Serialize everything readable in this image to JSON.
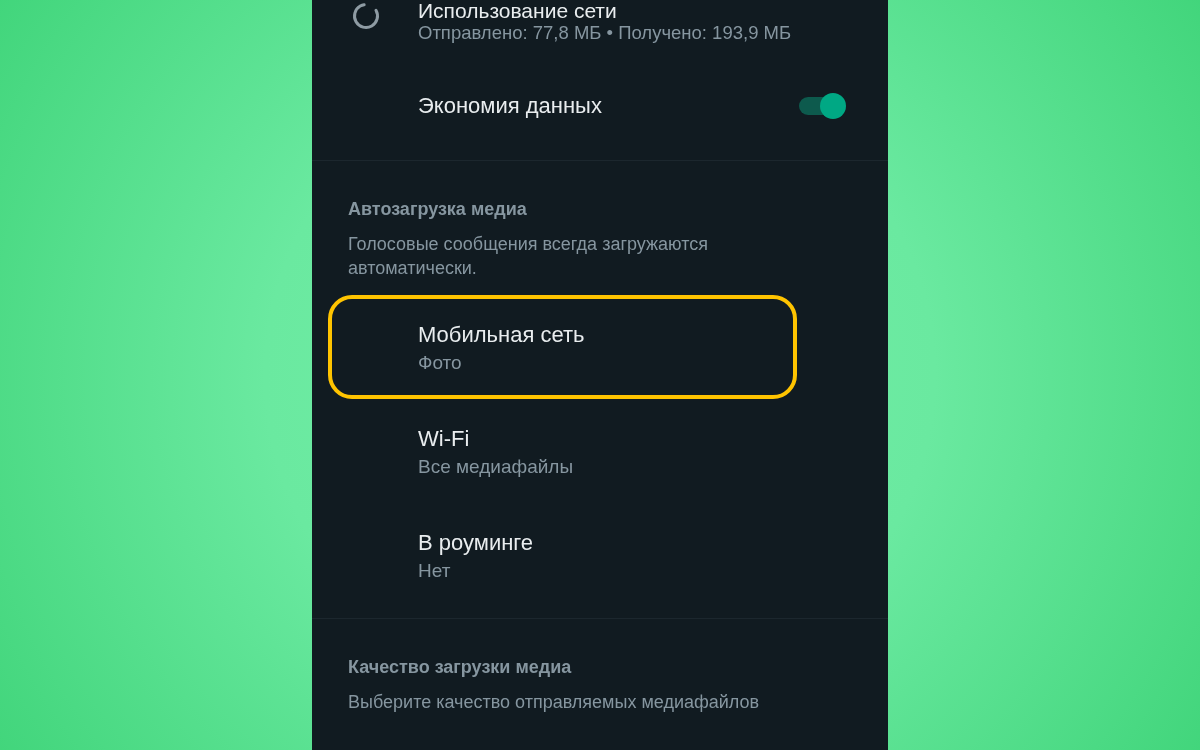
{
  "network_usage": {
    "title": "Использование сети",
    "subtitle": "Отправлено: 77,8 МБ • Получено: 193,9 МБ"
  },
  "data_saver": {
    "label": "Экономия данных",
    "on": true
  },
  "media_autodownload": {
    "header": "Автозагрузка медиа",
    "description": "Голосовые сообщения всегда загружаются автоматически.",
    "items": [
      {
        "title": "Мобильная сеть",
        "value": "Фото",
        "highlighted": true
      },
      {
        "title": "Wi-Fi",
        "value": "Все медиафайлы",
        "highlighted": false
      },
      {
        "title": "В роуминге",
        "value": "Нет",
        "highlighted": false
      }
    ]
  },
  "media_quality": {
    "header": "Качество загрузки медиа",
    "description": "Выберите качество отправляемых медиафайлов"
  }
}
